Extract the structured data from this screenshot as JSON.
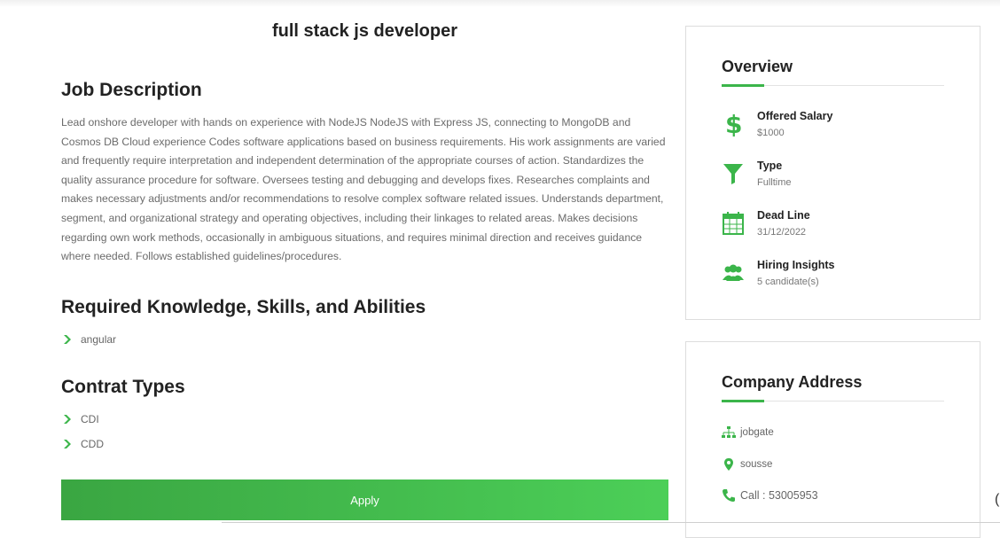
{
  "job": {
    "title": "full stack js developer",
    "description_heading": "Job Description",
    "description": "Lead onshore developer with hands on experience with NodeJS NodeJS with Express JS, connecting to MongoDB and Cosmos DB Cloud experience Codes software applications based on business requirements. His work assignments are varied and frequently require interpretation and independent determination of the appropriate courses of action. Standardizes the quality assurance procedure for software. Oversees testing and debugging and develops fixes. Researches complaints and makes necessary adjustments and/or recommendations to resolve complex software related issues. Understands department, segment, and organizational strategy and operating objectives, including their linkages to related areas. Makes decisions regarding own work methods, occasionally in ambiguous situations, and requires minimal direction and receives guidance where needed. Follows established guidelines/procedures.",
    "skills_heading": "Required Knowledge, Skills, and Abilities",
    "skills": [
      "angular"
    ],
    "contract_heading": "Contrat Types",
    "contracts": [
      "CDI",
      "CDD"
    ],
    "apply_label": "Apply"
  },
  "overview": {
    "title": "Overview",
    "items": [
      {
        "label": "Offered Salary",
        "value": "$1000",
        "icon": "dollar-icon"
      },
      {
        "label": "Type",
        "value": "Fulltime",
        "icon": "filter-icon"
      },
      {
        "label": "Dead Line",
        "value": "31/12/2022",
        "icon": "calendar-icon"
      },
      {
        "label": "Hiring Insights",
        "value": "5 candidate(s)",
        "icon": "users-icon"
      }
    ]
  },
  "address": {
    "title": "Company Address",
    "company": "jobgate",
    "city": "sousse",
    "phone": "Call : 53005953"
  },
  "colors": {
    "accent": "#3bb54a",
    "apply_start": "#3aa642",
    "apply_end": "#4ccf58"
  }
}
